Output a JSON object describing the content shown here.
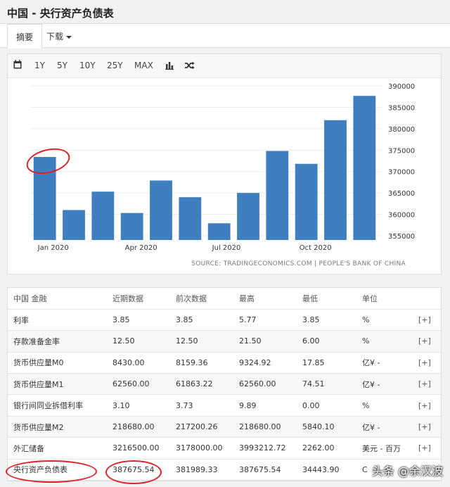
{
  "page": {
    "title": "中国 - 央行资产负债表"
  },
  "tabs": [
    {
      "label": "摘要"
    },
    {
      "label": "下载"
    }
  ],
  "toolbar": {
    "ranges": [
      "1Y",
      "5Y",
      "10Y",
      "25Y",
      "MAX"
    ],
    "icons": [
      "calendar-icon",
      "bar-chart-icon",
      "shuffle-icon"
    ]
  },
  "chart_data": {
    "type": "bar",
    "title": "",
    "xlabel": "",
    "ylabel": "",
    "x_tick_labels": {
      "0": "Jan 2020",
      "3": "Apr 2020",
      "6": "Jul 2020",
      "9": "Oct 2020"
    },
    "values": [
      373400,
      361000,
      365300,
      360300,
      367900,
      364000,
      357900,
      365000,
      374800,
      371800,
      382000,
      387675.54
    ],
    "ylim": [
      354000,
      391500
    ],
    "yticks": [
      355000,
      360000,
      365000,
      370000,
      375000,
      380000,
      385000,
      390000
    ],
    "color": "#3f7fbf",
    "grid": true
  },
  "source": "SOURCE: TRADINGECONOMICS.COM | PEOPLE'S BANK OF CHINA",
  "table": {
    "headers": [
      "中国 金融",
      "近期数据",
      "前次数据",
      "最高",
      "最低",
      "单位",
      ""
    ],
    "rows": [
      [
        "利率",
        "3.85",
        "3.85",
        "5.77",
        "3.85",
        "%",
        "[+]"
      ],
      [
        "存款准备金率",
        "12.50",
        "12.50",
        "21.50",
        "6.00",
        "%",
        "[+]"
      ],
      [
        "货币供应量M0",
        "8430.00",
        "8159.36",
        "9324.92",
        "17.85",
        "亿¥ -",
        "[+]"
      ],
      [
        "货币供应量M1",
        "62560.00",
        "61863.22",
        "62560.00",
        "74.51",
        "亿¥ -",
        "[+]"
      ],
      [
        "银行间同业拆借利率",
        "3.10",
        "3.73",
        "9.89",
        "0.00",
        "%",
        "[+]"
      ],
      [
        "货币供应量M2",
        "218680.00",
        "217200.26",
        "218680.00",
        "5840.10",
        "亿¥ -",
        "[+]"
      ],
      [
        "外汇储备",
        "3216500.00",
        "3178000.00",
        "3993212.72",
        "2262.00",
        "美元 - 百万",
        "[+]"
      ],
      [
        "央行资产负债表",
        "387675.54",
        "381989.33",
        "387675.54",
        "34443.90",
        "C",
        ""
      ]
    ]
  },
  "watermark": "头条 @余汉波"
}
